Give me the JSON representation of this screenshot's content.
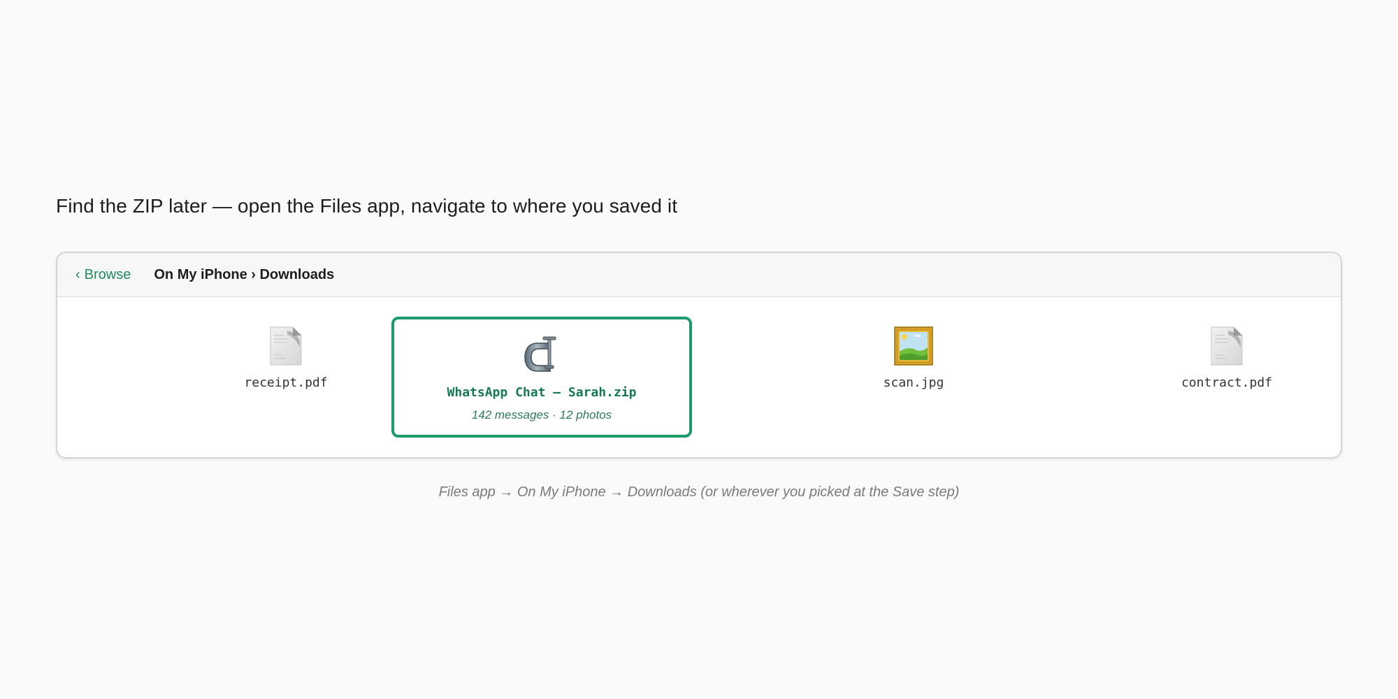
{
  "page_title": "Find the ZIP later — open the Files app, navigate to where you saved it",
  "nav": {
    "back_chevron": "‹",
    "back_label": "Browse",
    "breadcrumb": "On My iPhone › Downloads"
  },
  "files": [
    {
      "name": "receipt.pdf",
      "icon": "document-icon",
      "selected": false
    },
    {
      "name": "WhatsApp Chat — Sarah.zip",
      "icon": "archive-clamp-icon",
      "selected": true,
      "meta": "142 messages · 12 photos"
    },
    {
      "name": "scan.jpg",
      "icon": "framed-picture-icon",
      "selected": false
    },
    {
      "name": "contract.pdf",
      "icon": "document-icon",
      "selected": false
    }
  ],
  "caption": "Files app → On My iPhone → Downloads (or wherever you picked at the Save step)",
  "colors": {
    "accent": "#1c9a6a",
    "accent_text": "#157a52",
    "background": "#fafafa"
  }
}
